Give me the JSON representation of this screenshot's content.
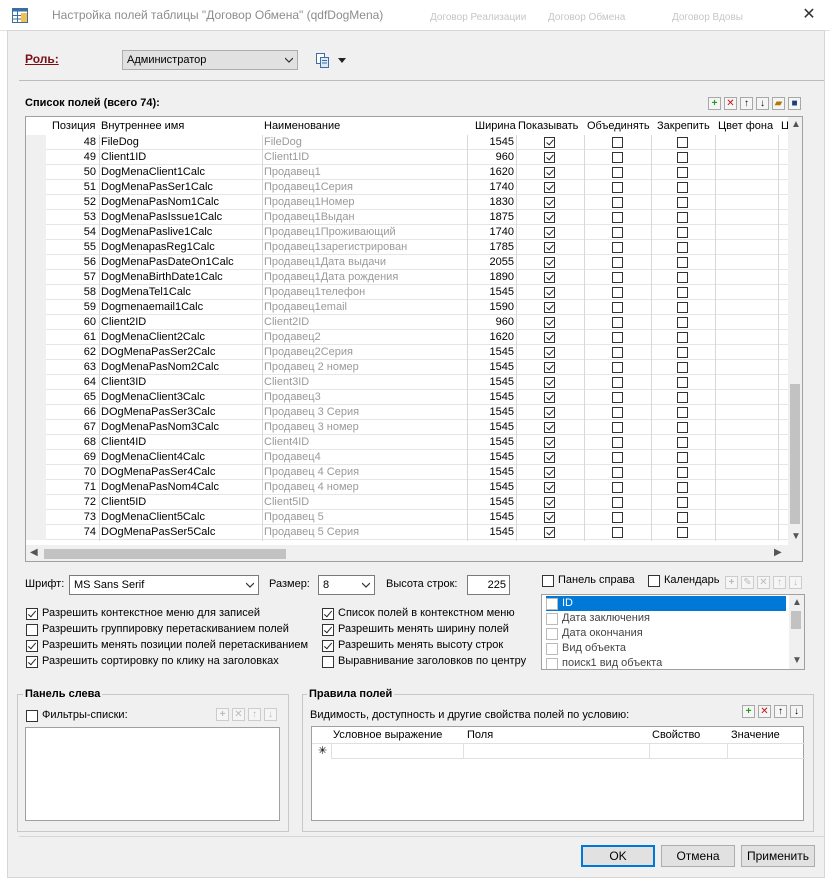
{
  "window": {
    "title": "Настройка полей таблицы \"Договор Обмена\" (qdfDogMena)",
    "background_tabs": [
      "Договор Реализации",
      "Договор Обмена",
      "Договор Вдовы"
    ],
    "close_glyph": "✕",
    "icon": "grid-table-icon"
  },
  "role": {
    "label": "Роль:",
    "value": "Администратор"
  },
  "fields": {
    "title": "Список полей (всего 74):",
    "columns": [
      "Позиция",
      "Внутреннее имя",
      "Наименование",
      "Ширина",
      "Показывать",
      "Объединять",
      "Закрепить",
      "Цвет фона",
      "Ц"
    ],
    "rows": [
      {
        "pos": "48",
        "name": "FileDog",
        "title": "FileDog",
        "width": "1545",
        "show": true
      },
      {
        "pos": "49",
        "name": "Client1ID",
        "title": "Client1ID",
        "width": "960",
        "show": true
      },
      {
        "pos": "50",
        "name": "DogMenaClient1Calc",
        "title": "Продавец1",
        "width": "1620",
        "show": true
      },
      {
        "pos": "51",
        "name": "DogMenaPasSer1Calc",
        "title": "Продавец1Серия",
        "width": "1740",
        "show": true
      },
      {
        "pos": "52",
        "name": "DogMenaPasNom1Calc",
        "title": "Продавец1Номер",
        "width": "1830",
        "show": true
      },
      {
        "pos": "53",
        "name": "DogMenaPasIssue1Calc",
        "title": "Продавец1Выдан",
        "width": "1875",
        "show": true
      },
      {
        "pos": "54",
        "name": "DogMenaPaslive1Calc",
        "title": "Продавец1Проживающий",
        "width": "1740",
        "show": true
      },
      {
        "pos": "55",
        "name": "DogMenapasReg1Calc",
        "title": "Продавец1зарегистрирован",
        "width": "1785",
        "show": true
      },
      {
        "pos": "56",
        "name": "DogMenaPasDateOn1Calc",
        "title": "Продавец1Дата выдачи",
        "width": "2055",
        "show": true
      },
      {
        "pos": "57",
        "name": "DogMenaBirthDate1Calc",
        "title": "Продавец1Дата рождения",
        "width": "1890",
        "show": true
      },
      {
        "pos": "58",
        "name": "DogMenaTel1Calc",
        "title": "Продавец1телефон",
        "width": "1545",
        "show": true
      },
      {
        "pos": "59",
        "name": "Dogmenaemail1Calc",
        "title": "Продавец1email",
        "width": "1590",
        "show": true
      },
      {
        "pos": "60",
        "name": "Client2ID",
        "title": "Client2ID",
        "width": "960",
        "show": true
      },
      {
        "pos": "61",
        "name": "DogMenaClient2Calc",
        "title": "Продавец2",
        "width": "1620",
        "show": true
      },
      {
        "pos": "62",
        "name": "DOgMenaPasSer2Calc",
        "title": "Продавец2Серия",
        "width": "1545",
        "show": true
      },
      {
        "pos": "63",
        "name": "DogMenaPasNom2Calc",
        "title": "Продавец 2 номер",
        "width": "1545",
        "show": true
      },
      {
        "pos": "64",
        "name": "Client3ID",
        "title": "Client3ID",
        "width": "1545",
        "show": true
      },
      {
        "pos": "65",
        "name": "DogMenaClient3Calc",
        "title": "Продавец3",
        "width": "1545",
        "show": true
      },
      {
        "pos": "66",
        "name": "DOgMenaPasSer3Calc",
        "title": "Продавец 3 Серия",
        "width": "1545",
        "show": true
      },
      {
        "pos": "67",
        "name": "DogMenaPasNom3Calc",
        "title": "Продавец 3 номер",
        "width": "1545",
        "show": true
      },
      {
        "pos": "68",
        "name": "Client4ID",
        "title": "Client4ID",
        "width": "1545",
        "show": true
      },
      {
        "pos": "69",
        "name": "DogMenaClient4Calc",
        "title": "Продавец4",
        "width": "1545",
        "show": true
      },
      {
        "pos": "70",
        "name": "DOgMenaPasSer4Calc",
        "title": "Продавец 4 Серия",
        "width": "1545",
        "show": true
      },
      {
        "pos": "71",
        "name": "DogMenaPasNom4Calc",
        "title": "Продавец 4 номер",
        "width": "1545",
        "show": true
      },
      {
        "pos": "72",
        "name": "Client5ID",
        "title": "Client5ID",
        "width": "1545",
        "show": true
      },
      {
        "pos": "73",
        "name": "DogMenaClient5Calc",
        "title": "Продавец 5",
        "width": "1545",
        "show": true
      },
      {
        "pos": "74",
        "name": "DOgMenaPasSer5Calc",
        "title": "Продавец 5 Серия",
        "width": "1545",
        "show": true
      }
    ]
  },
  "font": {
    "label": "Шрифт:",
    "value": "MS Sans Serif",
    "size_label": "Размер:",
    "size_value": "8",
    "row_height_label": "Высота строк:",
    "row_height_value": "225"
  },
  "panels": {
    "right_label": "Панель справа",
    "right_checked": false,
    "calendar_label": "Календарь",
    "calendar_checked": false,
    "calendar_items": [
      "ID",
      "Дата заключения",
      "Дата окончания",
      "Вид объекта",
      "поиск1 вид объекта"
    ]
  },
  "options": [
    {
      "label": "Разрешить контекстное меню для записей",
      "checked": true
    },
    {
      "label": "Разрешить группировку перетаскиванием полей",
      "checked": false
    },
    {
      "label": "Разрешить менять позиции полей перетаскиванием",
      "checked": true
    },
    {
      "label": "Разрешить сортировку по клику на заголовках",
      "checked": true
    },
    {
      "label": "Список полей в контекстном меню",
      "checked": true
    },
    {
      "label": "Разрешить менять ширину полей",
      "checked": true
    },
    {
      "label": "Разрешить менять высоту строк",
      "checked": true
    },
    {
      "label": "Выравнивание заголовков по центру",
      "checked": false
    }
  ],
  "left_panel": {
    "title": "Панель слева",
    "filters_label": "Фильтры-списки:",
    "filters_checked": false
  },
  "rules": {
    "title": "Правила полей",
    "subtitle": "Видимость, доступность и другие свойства полей по условию:",
    "columns": [
      "Условное выражение",
      "Поля",
      "Свойство",
      "Значение"
    ],
    "new_row_marker": "✳"
  },
  "buttons": {
    "ok": "OK",
    "cancel": "Отмена",
    "apply": "Применить"
  },
  "colors": {
    "role_label": "#7a0f16",
    "selection": "#0078d7",
    "add_icon": "#1a9e1a",
    "delete_icon": "#c81414"
  }
}
